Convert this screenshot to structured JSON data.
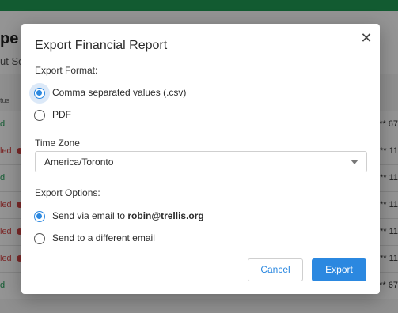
{
  "background": {
    "page_title": "pe",
    "subtitle": "ut Sch",
    "column_header": "tus",
    "rows": [
      {
        "status": "d",
        "kind": "ok",
        "account": "** 67"
      },
      {
        "status": "led",
        "kind": "fail",
        "account": "** 11"
      },
      {
        "status": "d",
        "kind": "ok",
        "account": "** 11"
      },
      {
        "status": "led",
        "kind": "fail",
        "account": "** 11"
      },
      {
        "status": "led",
        "kind": "fail",
        "account": "** 11"
      },
      {
        "status": "led",
        "kind": "fail",
        "account": "** 11"
      },
      {
        "status": "d",
        "kind": "ok",
        "account": "** 67"
      }
    ]
  },
  "modal": {
    "title": "Export Financial Report",
    "close_icon": "close-icon",
    "export_format": {
      "label": "Export Format:",
      "options": [
        {
          "label": "Comma separated values (.csv)",
          "selected": true
        },
        {
          "label": "PDF",
          "selected": false
        }
      ]
    },
    "time_zone": {
      "label": "Time Zone",
      "value": "America/Toronto"
    },
    "export_options": {
      "label": "Export Options:",
      "email_option_prefix": "Send via email to ",
      "email_option_address": "robin@trellis.org",
      "email_option_selected": true,
      "other_email_label": "Send to a different email",
      "other_email_selected": false
    },
    "buttons": {
      "cancel": "Cancel",
      "export": "Export"
    }
  },
  "colors": {
    "accent": "#2b88e0",
    "top_bar": "#1f9d55",
    "success": "#1f9d55",
    "failure": "#d64545"
  }
}
